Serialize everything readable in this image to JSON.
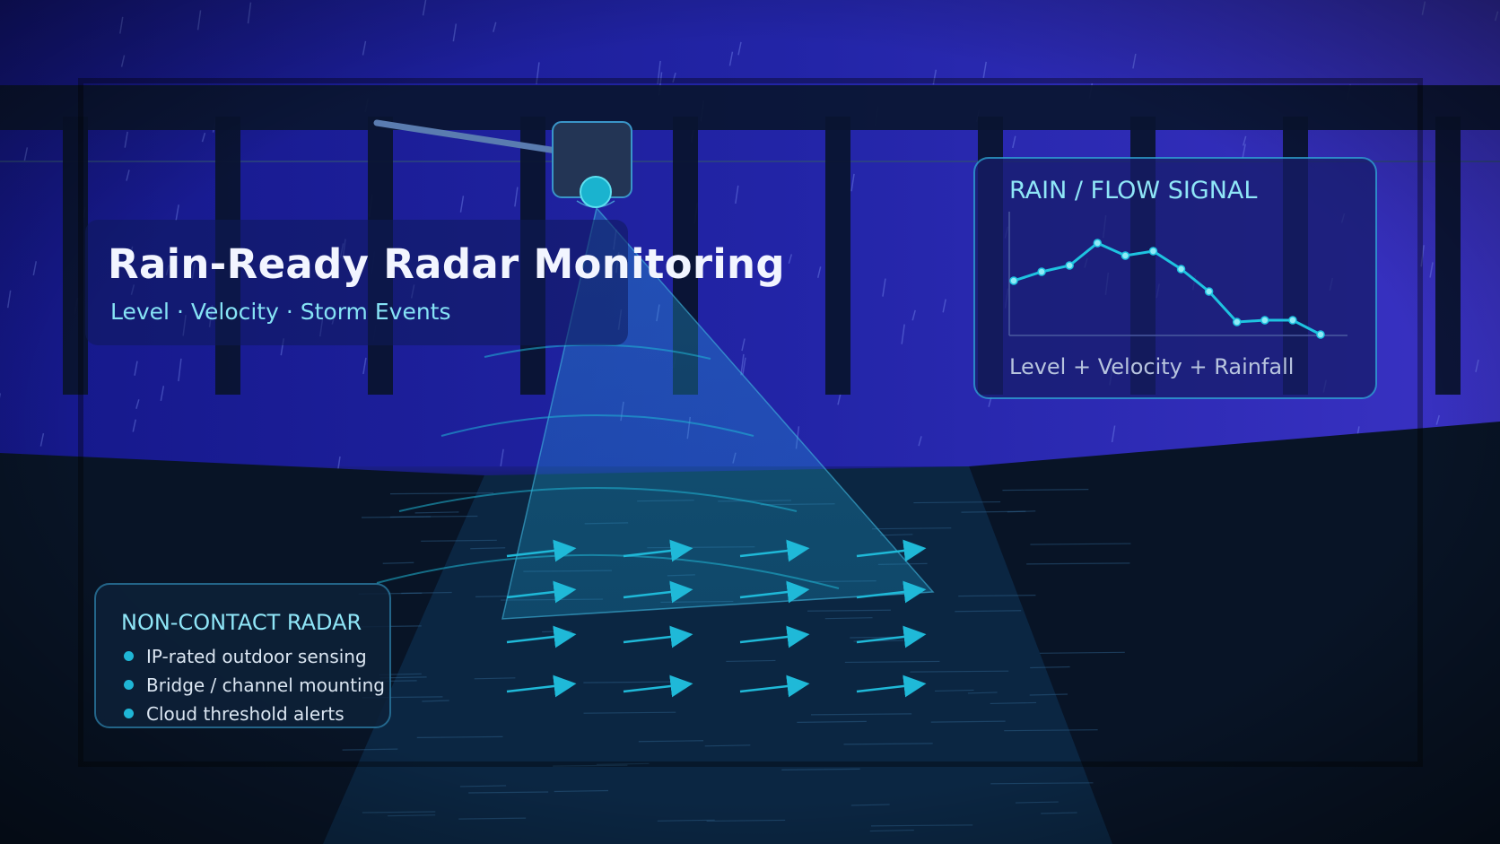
{
  "hero": {
    "title": "Rain-Ready Radar Monitoring",
    "subtitle": "Level · Velocity · Storm Events"
  },
  "signal_panel": {
    "heading": "RAIN / FLOW SIGNAL",
    "caption": "Level + Velocity + Rainfall",
    "line_color": "#1ec3e0",
    "values": [
      2.7,
      3.7,
      4.4,
      6.9,
      5.5,
      6.0,
      4.0,
      1.5,
      -1.9,
      -1.7,
      -1.7,
      -3.3
    ]
  },
  "radar_panel": {
    "heading": "NON-CONTACT RADAR",
    "features": [
      "IP-rated outdoor sensing",
      "Bridge / channel mounting",
      "Cloud threshold alerts"
    ]
  },
  "colors": {
    "accent": "#1ec3e0",
    "sky": "#2a2ab0",
    "water": "#0b2642"
  },
  "icons": {
    "sensor": "radar-sensor-icon",
    "bullet": "bullet-dot-icon",
    "flow": "flow-arrow-icon"
  }
}
